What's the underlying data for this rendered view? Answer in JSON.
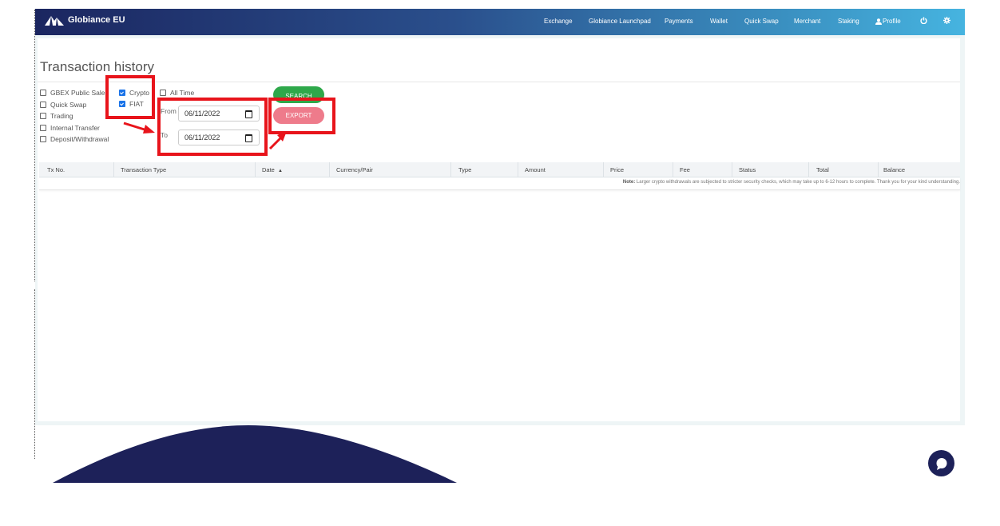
{
  "brand": {
    "name": "Globiance EU",
    "icon": "mountain-logo-icon"
  },
  "nav": {
    "exchange": "Exchange",
    "launchpad": "Globiance Launchpad",
    "payments": "Payments",
    "wallet": "Wallet",
    "quick_swap": "Quick Swap",
    "merchant": "Merchant",
    "staking": "Staking",
    "profile": "Profile",
    "icons": [
      "user-icon",
      "power-icon",
      "gear-icon"
    ]
  },
  "page": {
    "title": "Transaction history"
  },
  "filters": {
    "gbex": {
      "label": "GBEX Public Sale",
      "checked": false
    },
    "quick_swap": {
      "label": "Quick Swap",
      "checked": false
    },
    "trading": {
      "label": "Trading",
      "checked": false
    },
    "internal_transfer": {
      "label": "Internal Transfer",
      "checked": false
    },
    "deposit_withdrawal": {
      "label": "Deposit/Withdrawal",
      "checked": false
    },
    "crypto": {
      "label": "Crypto",
      "checked": true
    },
    "fiat": {
      "label": "FIAT",
      "checked": true
    },
    "all_time": {
      "label": "All Time",
      "checked": false
    }
  },
  "date_range": {
    "from_label": "From",
    "from_value": "06/11/2022",
    "to_label": "To",
    "to_value": "06/11/2022"
  },
  "actions": {
    "search": "SEARCH",
    "export": "EXPORT"
  },
  "table": {
    "columns": {
      "tx_no": "Tx No.",
      "transaction_type": "Transaction Type",
      "date": "Date",
      "currency_pair": "Currency/Pair",
      "type": "Type",
      "amount": "Amount",
      "price": "Price",
      "fee": "Fee",
      "status": "Status",
      "total": "Total",
      "balance": "Balance"
    },
    "note_label": "Note:",
    "note_text": "Larger crypto withdrawals are subjected to stricter security checks, which may take up to 6-12 hours to complete. Thank you for your kind understanding."
  },
  "colors": {
    "highlight": "#e8141b",
    "search_button": "#2ea84a",
    "export_button": "#ee7b8b",
    "nav_start": "#1b2660",
    "nav_end": "#46b4e0",
    "wave": "#1d2159"
  }
}
